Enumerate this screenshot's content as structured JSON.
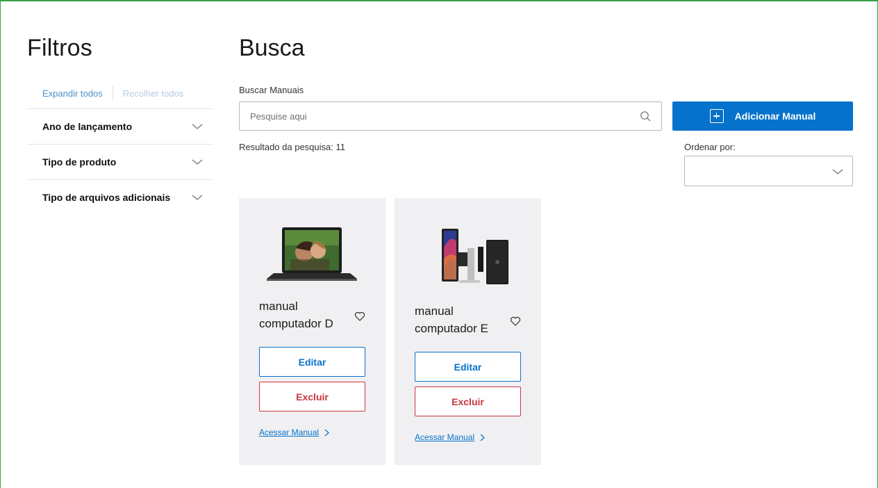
{
  "sidebar": {
    "title": "Filtros",
    "expand_all": "Expandir todos",
    "collapse_all": "Recolher todos",
    "filters": [
      {
        "label": "Ano de lançamento"
      },
      {
        "label": "Tipo de produto"
      },
      {
        "label": "Tipo de arquivos adicionais"
      }
    ]
  },
  "main": {
    "title": "Busca",
    "search_label": "Buscar Manuais",
    "search_placeholder": "Pesquise aqui",
    "add_button": "Adicionar Manual",
    "result_text": "Resultado da pesquisa: 11",
    "order_label": "Ordenar por:",
    "order_value": ""
  },
  "cards": [
    {
      "name": "manual computador D",
      "image": "laptop",
      "edit": "Editar",
      "delete": "Excluir",
      "link": "Acessar Manual"
    },
    {
      "name": "manual computador E",
      "image": "desktop-tower-monitor",
      "edit": "Editar",
      "delete": "Excluir",
      "link": "Acessar Manual"
    }
  ],
  "colors": {
    "primary": "#0672cb",
    "danger": "#c9353f",
    "card_bg": "#f0f0f3",
    "frame_border": "#36a14a"
  }
}
